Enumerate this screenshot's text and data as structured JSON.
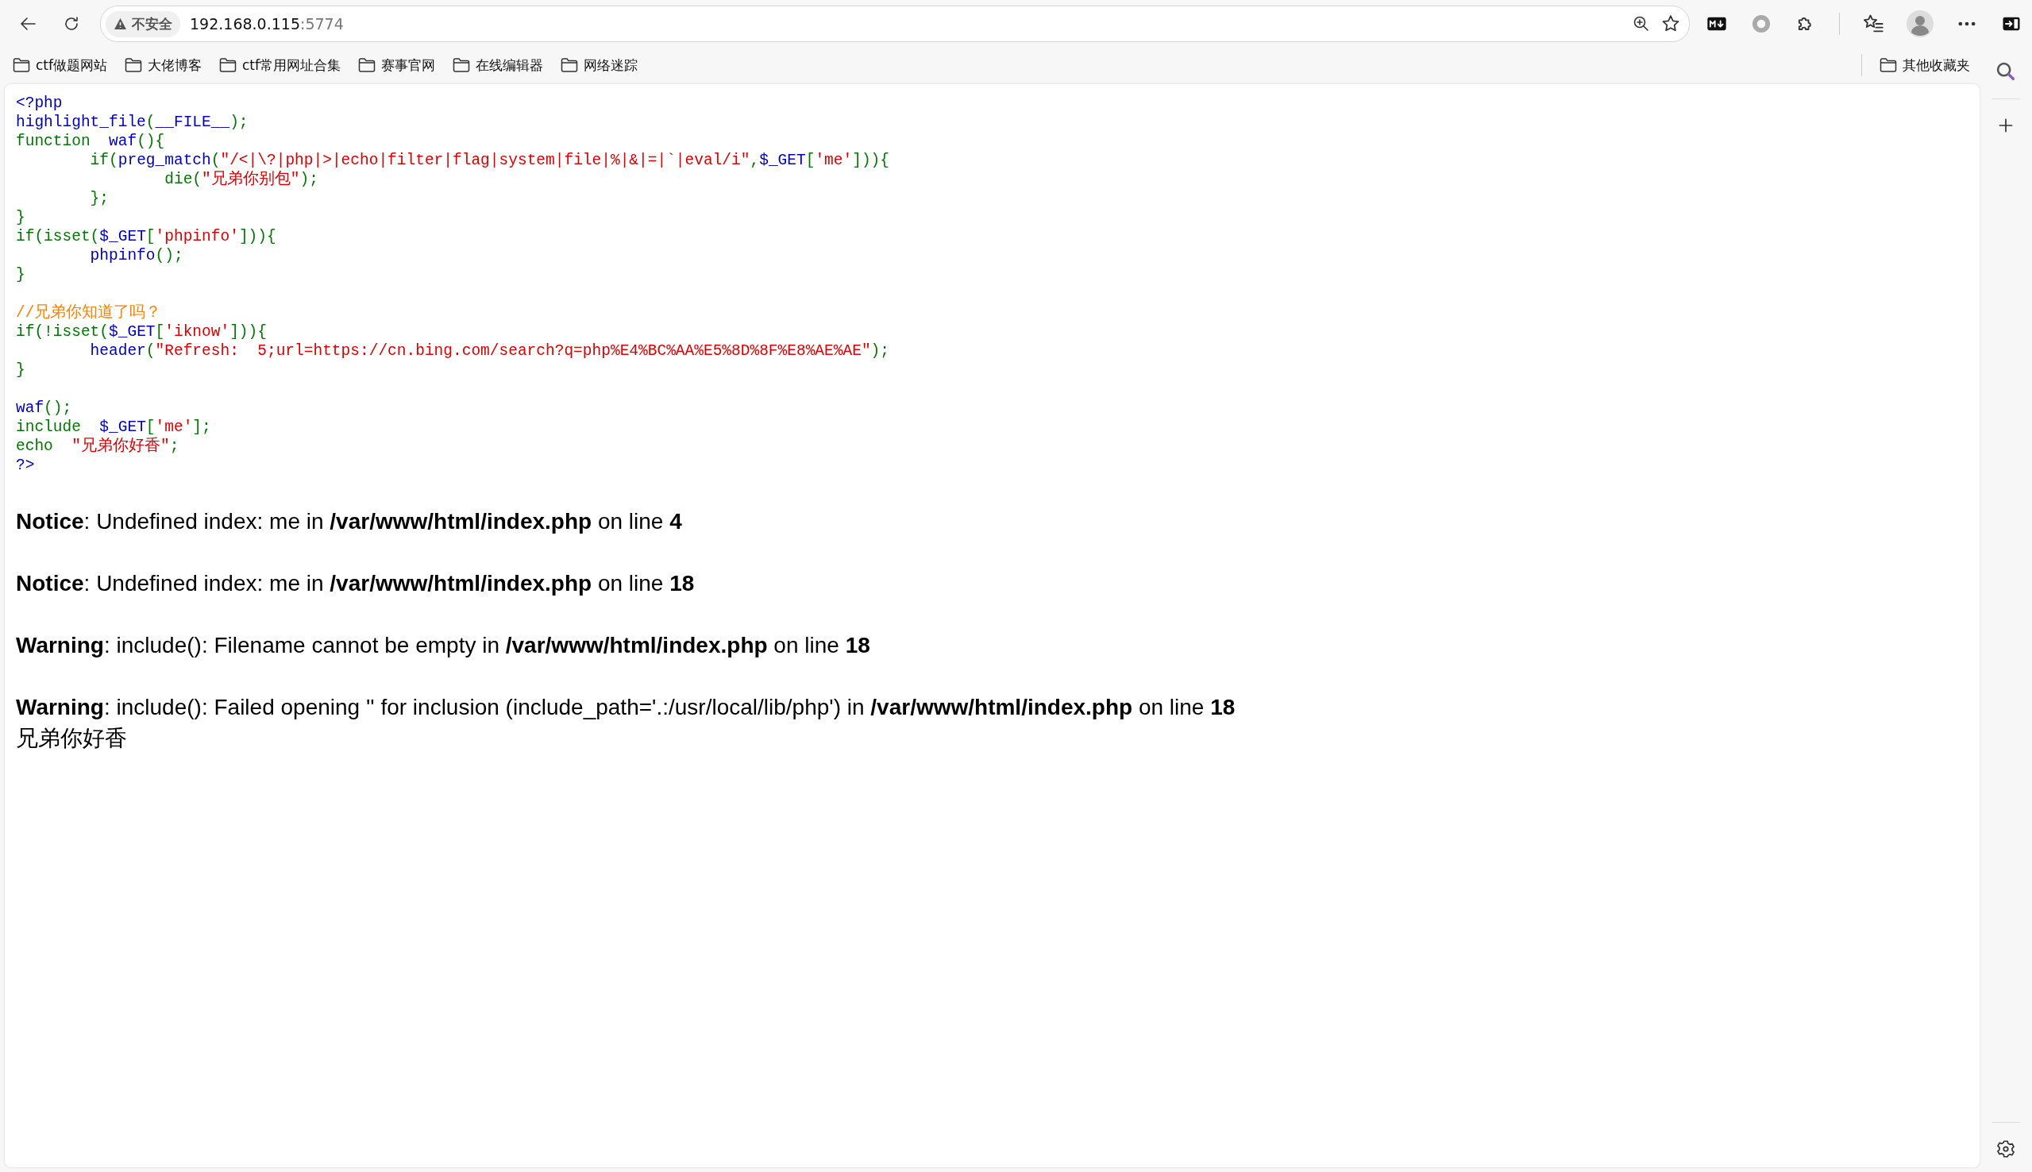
{
  "browser": {
    "security_label": "不安全",
    "url_host": "192.168.0.115",
    "url_port": ":5774"
  },
  "bookmarks": [
    {
      "label": "ctf做题网站"
    },
    {
      "label": "大佬博客"
    },
    {
      "label": "ctf常用网址合集"
    },
    {
      "label": "赛事官网"
    },
    {
      "label": "在线编辑器"
    },
    {
      "label": "网络迷踪"
    }
  ],
  "other_bookmarks": "其他收藏夹",
  "code_lines": [
    {
      "kind": "code",
      "tokens": [
        {
          "kind": "default",
          "text": "<?php"
        }
      ]
    },
    {
      "kind": "code",
      "tokens": [
        {
          "kind": "default",
          "text": "highlight_file"
        },
        {
          "kind": "keyword",
          "text": "("
        },
        {
          "kind": "default",
          "text": "__FILE__"
        },
        {
          "kind": "keyword",
          "text": ");"
        }
      ]
    },
    {
      "kind": "code",
      "tokens": [
        {
          "kind": "keyword",
          "text": "function  "
        },
        {
          "kind": "default",
          "text": "waf"
        },
        {
          "kind": "keyword",
          "text": "(){"
        }
      ]
    },
    {
      "kind": "code",
      "tokens": [
        {
          "kind": "keyword",
          "text": "        if("
        },
        {
          "kind": "default",
          "text": "preg_match"
        },
        {
          "kind": "keyword",
          "text": "("
        },
        {
          "kind": "string",
          "text": "\"/<|\\?|php|>|echo|filter|flag|system|file|%|&|=|`|eval/i\""
        },
        {
          "kind": "keyword",
          "text": ","
        },
        {
          "kind": "default",
          "text": "$_GET"
        },
        {
          "kind": "keyword",
          "text": "["
        },
        {
          "kind": "string",
          "text": "'me'"
        },
        {
          "kind": "keyword",
          "text": "])){"
        }
      ]
    },
    {
      "kind": "code",
      "tokens": [
        {
          "kind": "keyword",
          "text": "                die("
        },
        {
          "kind": "string",
          "text": "\"兄弟你别包\""
        },
        {
          "kind": "keyword",
          "text": ");"
        }
      ]
    },
    {
      "kind": "code",
      "tokens": [
        {
          "kind": "keyword",
          "text": "        };"
        }
      ]
    },
    {
      "kind": "code",
      "tokens": [
        {
          "kind": "keyword",
          "text": "}"
        }
      ]
    },
    {
      "kind": "code",
      "tokens": [
        {
          "kind": "keyword",
          "text": "if(isset("
        },
        {
          "kind": "default",
          "text": "$_GET"
        },
        {
          "kind": "keyword",
          "text": "["
        },
        {
          "kind": "string",
          "text": "'phpinfo'"
        },
        {
          "kind": "keyword",
          "text": "])){"
        }
      ]
    },
    {
      "kind": "code",
      "tokens": [
        {
          "kind": "default",
          "text": "        phpinfo"
        },
        {
          "kind": "keyword",
          "text": "();"
        }
      ]
    },
    {
      "kind": "code",
      "tokens": [
        {
          "kind": "keyword",
          "text": "}"
        }
      ]
    },
    {
      "kind": "blank"
    },
    {
      "kind": "code",
      "tokens": [
        {
          "kind": "comment",
          "text": "//兄弟你知道了吗？"
        }
      ]
    },
    {
      "kind": "code",
      "tokens": [
        {
          "kind": "keyword",
          "text": "if(!isset("
        },
        {
          "kind": "default",
          "text": "$_GET"
        },
        {
          "kind": "keyword",
          "text": "["
        },
        {
          "kind": "string",
          "text": "'iknow'"
        },
        {
          "kind": "keyword",
          "text": "])){"
        }
      ]
    },
    {
      "kind": "code",
      "tokens": [
        {
          "kind": "default",
          "text": "        header"
        },
        {
          "kind": "keyword",
          "text": "("
        },
        {
          "kind": "string",
          "text": "\"Refresh:  5;url=https://cn.bing.com/search?q=php%E4%BC%AA%E5%8D%8F%E8%AE%AE\""
        },
        {
          "kind": "keyword",
          "text": ");"
        }
      ]
    },
    {
      "kind": "code",
      "tokens": [
        {
          "kind": "keyword",
          "text": "}"
        }
      ]
    },
    {
      "kind": "blank"
    },
    {
      "kind": "code",
      "tokens": [
        {
          "kind": "default",
          "text": "waf"
        },
        {
          "kind": "keyword",
          "text": "();"
        }
      ]
    },
    {
      "kind": "code",
      "tokens": [
        {
          "kind": "keyword",
          "text": "include  "
        },
        {
          "kind": "default",
          "text": "$_GET"
        },
        {
          "kind": "keyword",
          "text": "["
        },
        {
          "kind": "string",
          "text": "'me'"
        },
        {
          "kind": "keyword",
          "text": "];"
        }
      ]
    },
    {
      "kind": "code",
      "tokens": [
        {
          "kind": "keyword",
          "text": "echo  "
        },
        {
          "kind": "string",
          "text": "\"兄弟你好香\""
        },
        {
          "kind": "keyword",
          "text": ";"
        }
      ]
    },
    {
      "kind": "code",
      "tokens": [
        {
          "kind": "default",
          "text": "?>"
        }
      ]
    }
  ],
  "messages": [
    "**Notice**: Undefined index: me in **/var/www/html/index.php** on line **4**",
    "**Notice**: Undefined index: me in **/var/www/html/index.php** on line **18**",
    "**Warning**: include(): Filename cannot be empty in **/var/www/html/index.php** on line **18**",
    "**Warning**: include(): Failed opening '' for inclusion (include_path='.:/usr/local/lib/php') in **/var/www/html/index.php** on line **18**"
  ],
  "output": "兄弟你好香"
}
